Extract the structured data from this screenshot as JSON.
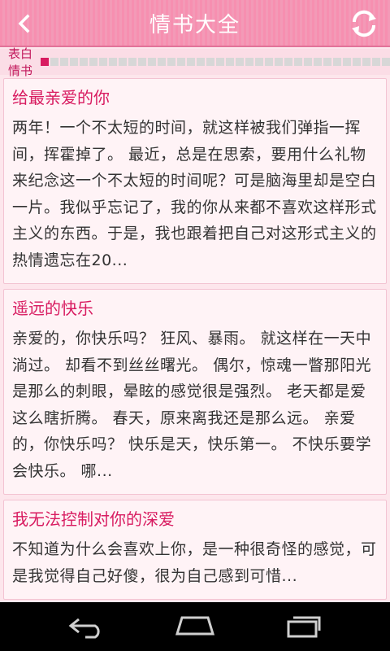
{
  "header": {
    "title": "情书大全",
    "back_icon": "chevron-left-icon",
    "refresh_icon": "refresh-icon",
    "bg_color": "#f78fb0"
  },
  "tab": {
    "label": "表白情书",
    "progress_total": 36,
    "progress_current": 1,
    "accent_color": "#d81b60"
  },
  "articles": [
    {
      "title": "给最亲爱的你",
      "excerpt": "两年！一个不太短的时间，就这样被我们弹指一挥间，挥霍掉了。 最近，总是在思索，要用什么礼物来纪念这一个不太短的时间呢？可是脑海里却是空白一片。我似乎忘记了，我的你从来都不喜欢这样形式主义的东西。于是，我也跟着把自己对这形式主义的热情遗忘在20..."
    },
    {
      "title": "遥远的快乐",
      "excerpt": "亲爱的，你快乐吗？ 狂风、暴雨。 就这样在一天中淌过。 却看不到丝丝曙光。 偶尔，惊魂一瞥那阳光是那么的刺眼，晕眩的感觉很是强烈。 老天都是爱这么瞎折腾。 春天，原来离我还是那么远。 亲爱的，你快乐吗？ 快乐是天，快乐第一。 不快乐要学会快乐。 哪..."
    },
    {
      "title": "我无法控制对你的深爱",
      "excerpt": "不知道为什么会喜欢上你，是一种很奇怪的感觉，可是我觉得自己好傻，很为自己感到可惜..."
    }
  ],
  "navbar": {
    "back_icon": "nav-back-icon",
    "home_icon": "nav-home-icon",
    "recents_icon": "nav-recents-icon"
  }
}
